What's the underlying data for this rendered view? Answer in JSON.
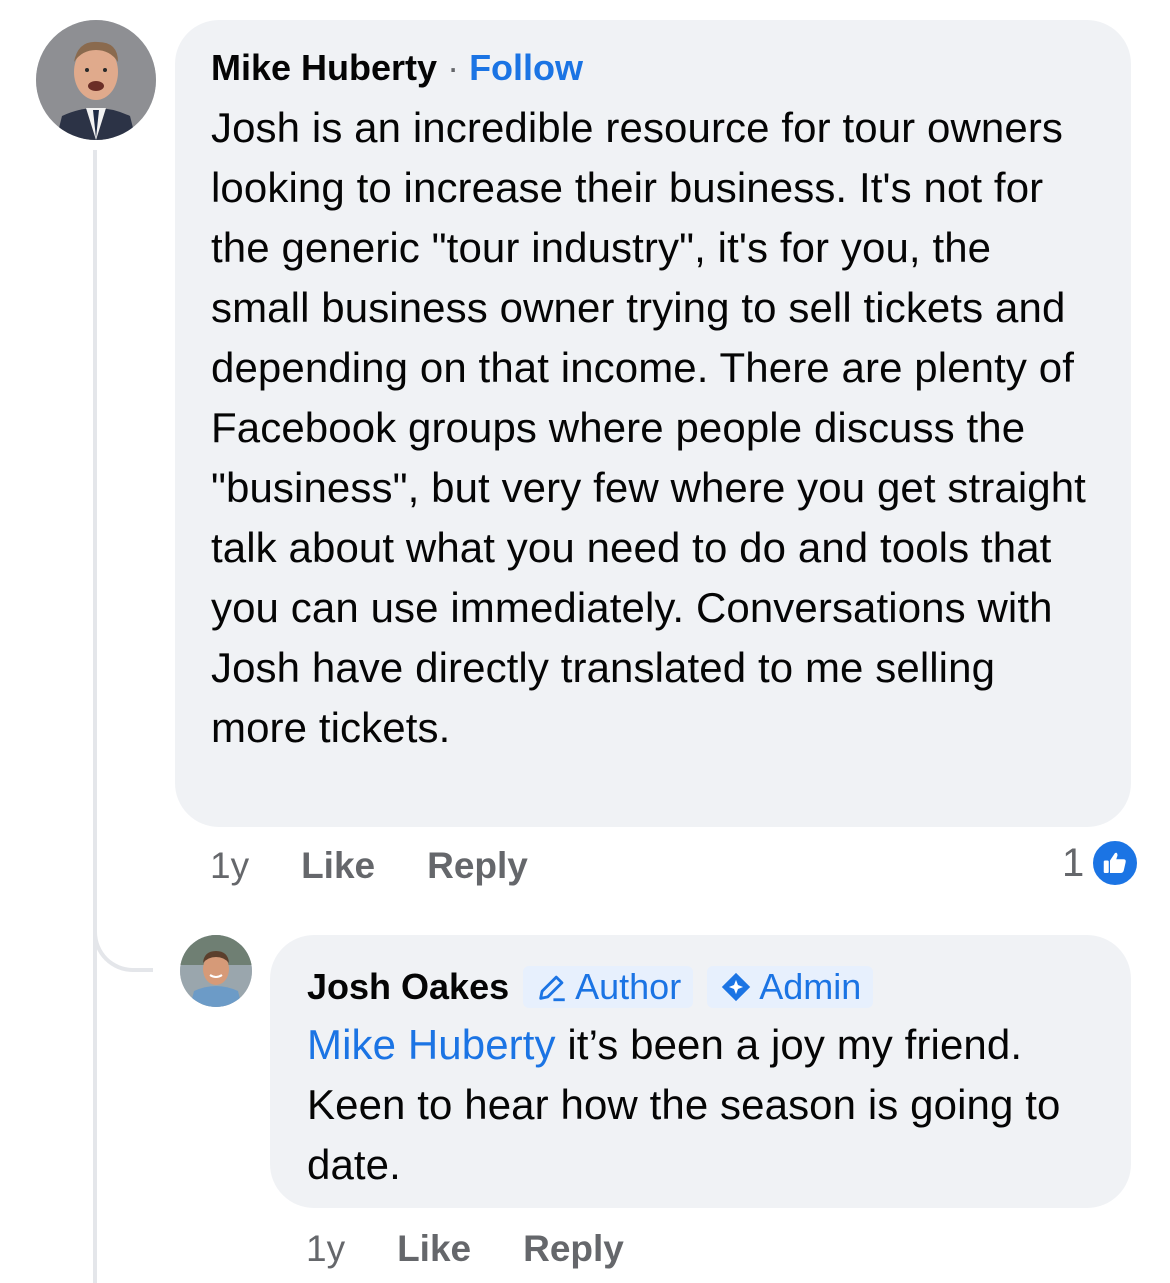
{
  "comment": {
    "author": "Mike Huberty",
    "separator": "·",
    "follow_label": "Follow",
    "text": "Josh is an incredible resource for tour owners looking to increase their business. It's not for the generic \"tour industry\", it's for you, the small business owner trying to sell tickets and depending on that income. There are plenty of Facebook groups where people discuss the \"business\", but very few where you get straight talk about what you need to do and tools that you can use immediately. Conversations with Josh have directly translated to me selling more tickets.",
    "time": "1y",
    "like_label": "Like",
    "reply_label": "Reply",
    "reaction_count": "1"
  },
  "reply": {
    "author": "Josh Oakes",
    "badges": [
      {
        "label": "Author",
        "icon": "pencil-icon"
      },
      {
        "label": "Admin",
        "icon": "admin-shield-icon"
      }
    ],
    "mention": "Mike Huberty",
    "text": " it’s been a joy my friend. Keen to hear how the season is going to date.",
    "time": "1y",
    "like_label": "Like",
    "reply_label": "Reply"
  },
  "colors": {
    "accent": "#1b74e4",
    "bubble": "#f0f2f5",
    "muted": "#65676b",
    "text": "#050505"
  }
}
